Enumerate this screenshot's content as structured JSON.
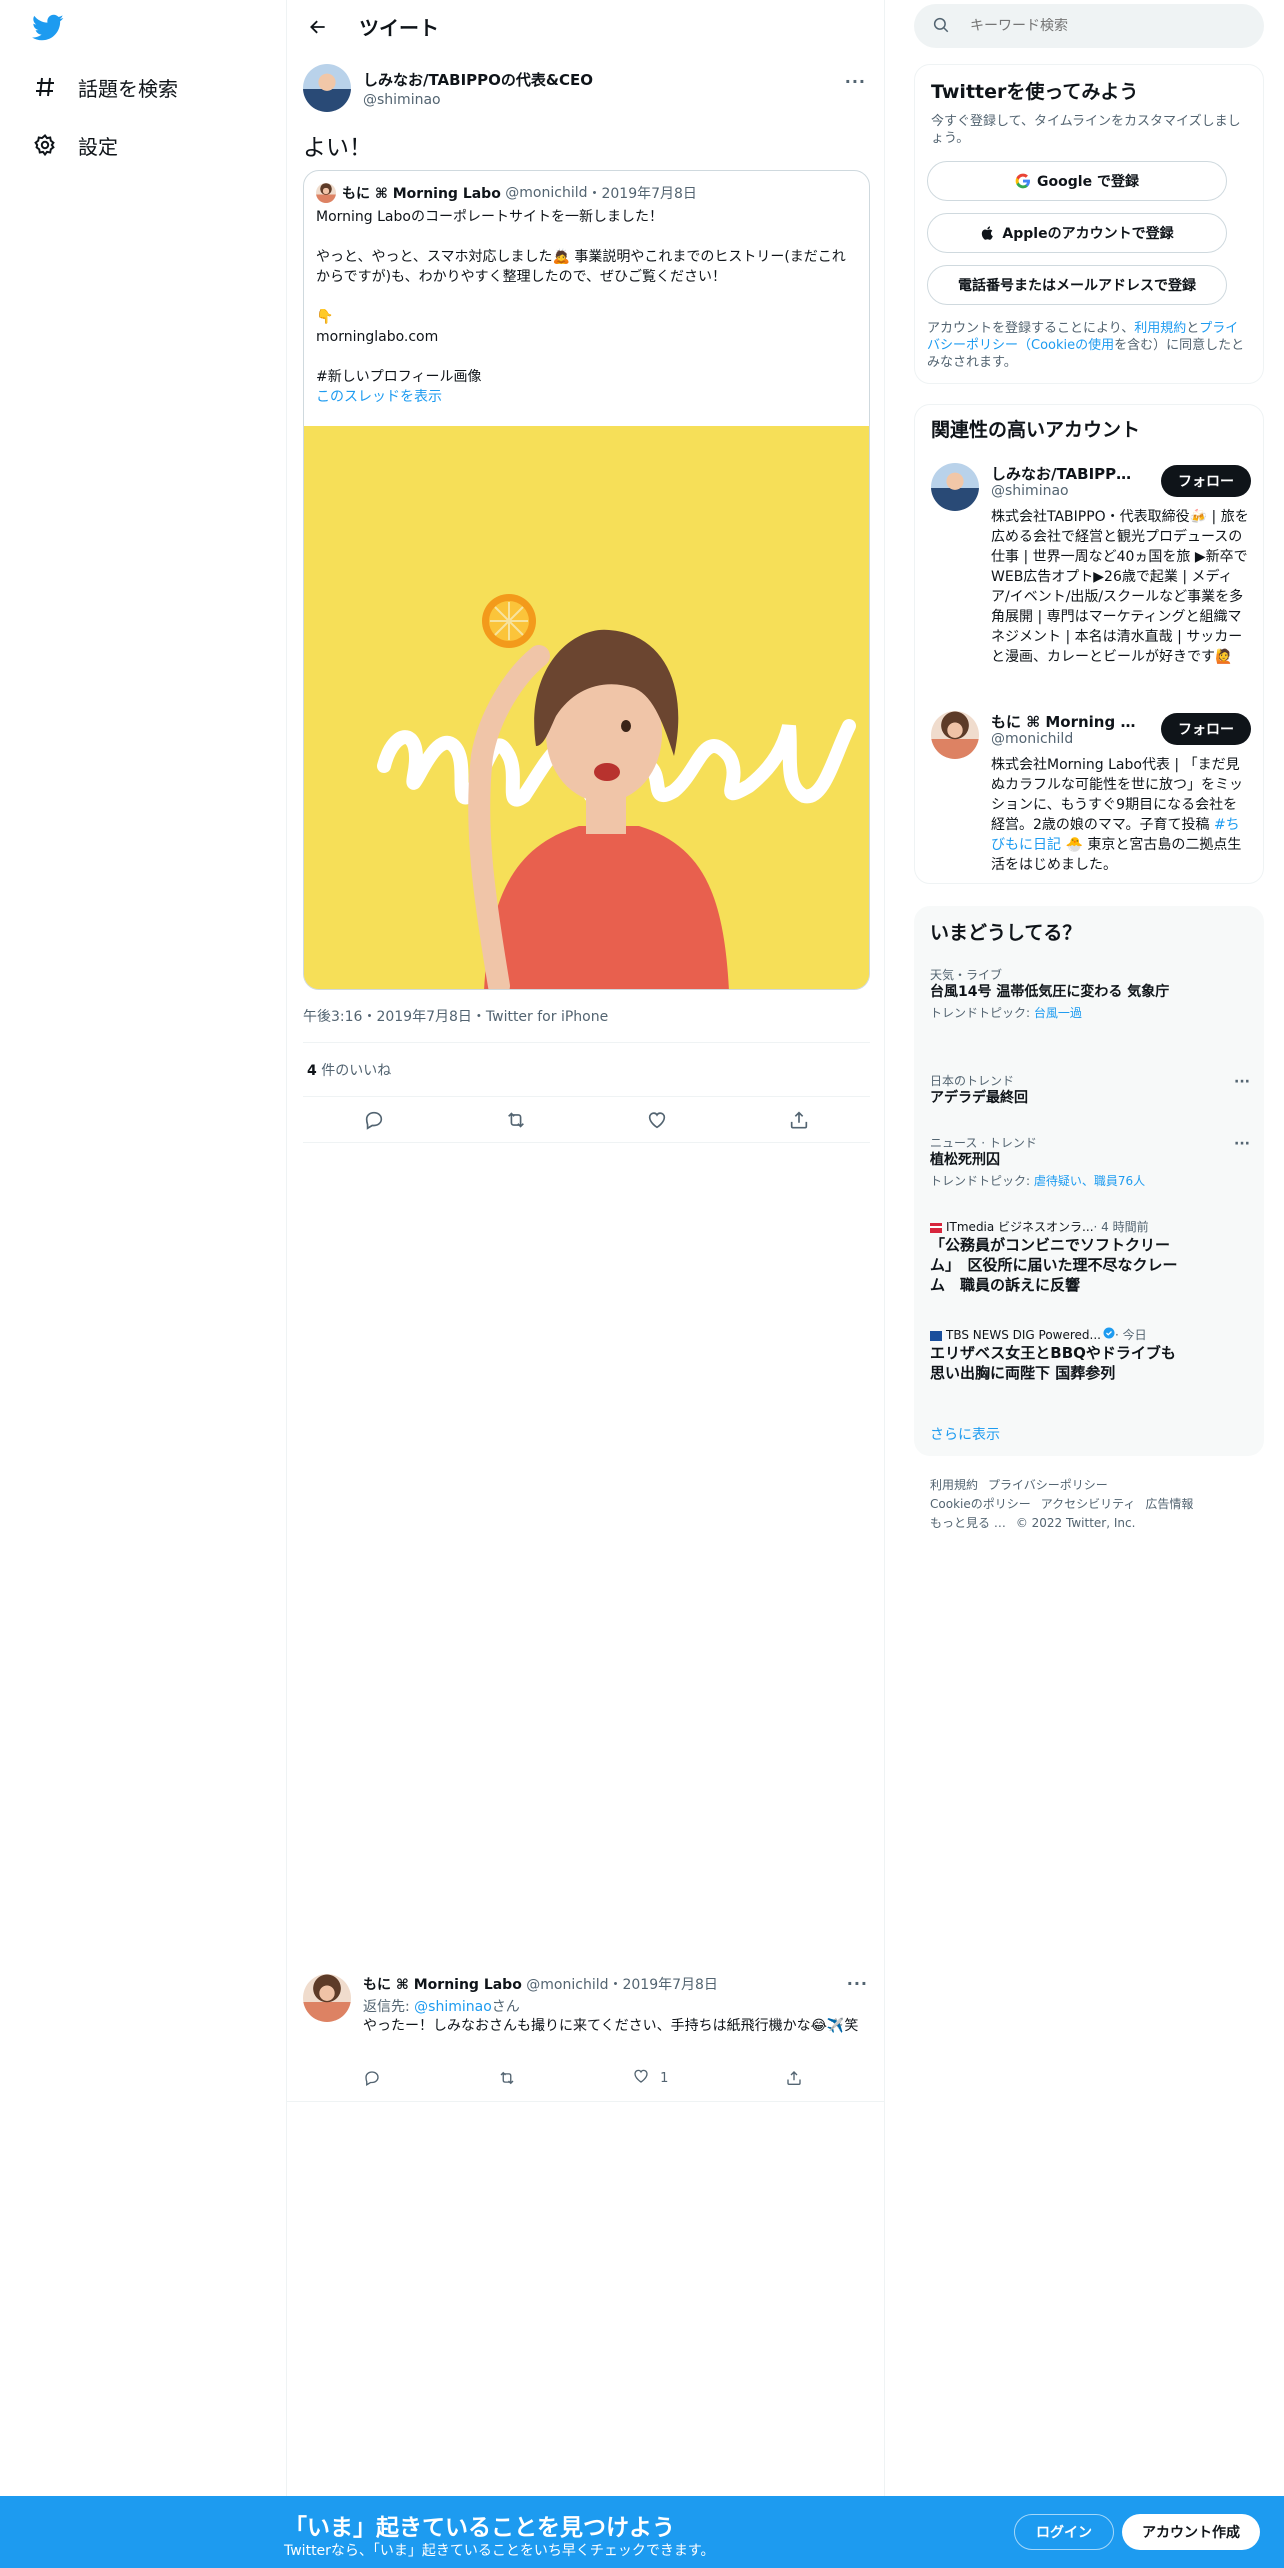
{
  "colors": {
    "accent": "#1d9bf0",
    "text": "#0f1419",
    "muted": "#536471",
    "border": "#eff3f4",
    "media_bg": "#f6df58"
  },
  "nav": {
    "logo_icon": "twitter-bird-icon",
    "items": [
      {
        "icon": "hashtag-icon",
        "label": "話題を検索"
      },
      {
        "icon": "gear-icon",
        "label": "設定"
      }
    ]
  },
  "header": {
    "back_icon": "arrow-left-icon",
    "title": "ツイート"
  },
  "tweet": {
    "author_name": "しみなお/TABIPPOの代表&CEO",
    "author_handle": "@shiminao",
    "more_label": "···",
    "text": "よい！",
    "quote": {
      "author_name": "もに ⌘ Morning Labo",
      "author_handle": "@monichild",
      "date": "2019年7月8日",
      "lines": [
        "Morning Laboのコーポレートサイトを一新しました！",
        "やっと、やっと、スマホ対応しました🙇 事業説明やこれまでのヒストリー(まだこれからですが)も、わかりやすく整理したので、ぜひご覧ください！",
        "👇",
        "morninglabo.com",
        " #新しいプロフィール画像"
      ],
      "thread_link": "このスレッドを表示",
      "media_text": "moni"
    },
    "meta": "午後3:16・2019年7月8日・Twitter for iPhone",
    "like_count": "4",
    "like_label": " 件のいいね"
  },
  "reply": {
    "author_name": "もに ⌘ Morning Labo",
    "author_handle": "@monichild",
    "date": "2019年7月8日",
    "to_prefix": "返信先: ",
    "to_handle": "@shiminao",
    "to_suffix": "さん",
    "text": "やったー！しみなおさんも撮りに来てください、手持ちは紙飛行機かな😂✈️笑",
    "like_count": "1"
  },
  "search": {
    "placeholder": "キーワード検索"
  },
  "signup": {
    "title": "Twitterを使ってみよう",
    "subtitle": "今すぐ登録して、タイムラインをカスタマイズしましょう。",
    "google": "Google で登録",
    "apple": "Appleのアカウントで登録",
    "phone": "電話番号またはメールアドレスで登録",
    "legal_1": "アカウントを登録することにより、",
    "legal_terms": "利用規約",
    "legal_2": "と",
    "legal_privacy": "プライバシーポリシー（Cookieの使用",
    "legal_3": "を含む）に同意したとみなされます。"
  },
  "relevant": {
    "title": "関連性の高いアカウント",
    "follow_label": "フォロー",
    "accounts": [
      {
        "name": "しみなお/TABIPPOの代表&CEO",
        "handle": "@shiminao",
        "bio": "株式会社TABIPPO・代表取締役🍻 | 旅を広める会社で経営と観光プロデュースの仕事 | 世界一周など40ヵ国を旅 ▶新卒でWEB広告オプト▶26歳で起業 | メディア/イベント/出版/スクールなど事業を多角展開 | 専門はマーケティングと組織マネジメント | 本名は清水直哉 | サッカーと漫画、カレーとビールが好きです🙋"
      },
      {
        "name": "もに ⌘ Morning Labo",
        "handle": "@monichild",
        "bio_1": "株式会社Morning Labo代表 | 「まだ見ぬカラフルな可能性を世に放つ」をミッションに、もうすぐ9期目になる会社を経営。2歳の娘のママ。子育て投稿 ",
        "bio_link": "#ちびもに日記",
        "bio_2": " 🐣 東京と宮古島の二拠点生活をはじめました。"
      }
    ]
  },
  "trends": {
    "title": "いまどうしてる？",
    "items": [
      {
        "category": "天気・ライブ",
        "title": "台風14号 温帯低気圧に変わる 気象庁",
        "sub_prefix": "トレンドトピック: ",
        "sub_link": "台風一過"
      },
      {
        "category": "日本のトレンド",
        "title": "アデラデ最終回",
        "more": "···"
      },
      {
        "category": "ニュース · トレンド",
        "title": "植松死刑囚",
        "sub_prefix": "トレンドトピック: ",
        "sub_link": "虐待疑い、職員76人",
        "more": "···"
      }
    ],
    "news": [
      {
        "source": "ITmedia ビジネスオンラ...",
        "time": " · 4 時間前",
        "title": "「公務員がコンビニでソフトクリーム」　区役所に届いた理不尽なクレーム　職員の訴えに反響"
      },
      {
        "source": "TBS NEWS DIG Powered...",
        "time": " · 今日",
        "title": "エリザベス女王とBBQやドライブも　思い出胸に両陛下 国葬参列"
      }
    ],
    "show_more": "さらに表示"
  },
  "footer": {
    "links": [
      "利用規約",
      "プライバシーポリシー",
      "Cookieのポリシー",
      "アクセシビリティ",
      "広告情報",
      "もっと見る …",
      "© 2022 Twitter, Inc."
    ]
  },
  "bottom_bar": {
    "title": "「いま」起きていることを見つけよう",
    "subtitle": "Twitterなら、「いま」起きていることをいち早くチェックできます。",
    "login": "ログイン",
    "signup": "アカウント作成"
  }
}
